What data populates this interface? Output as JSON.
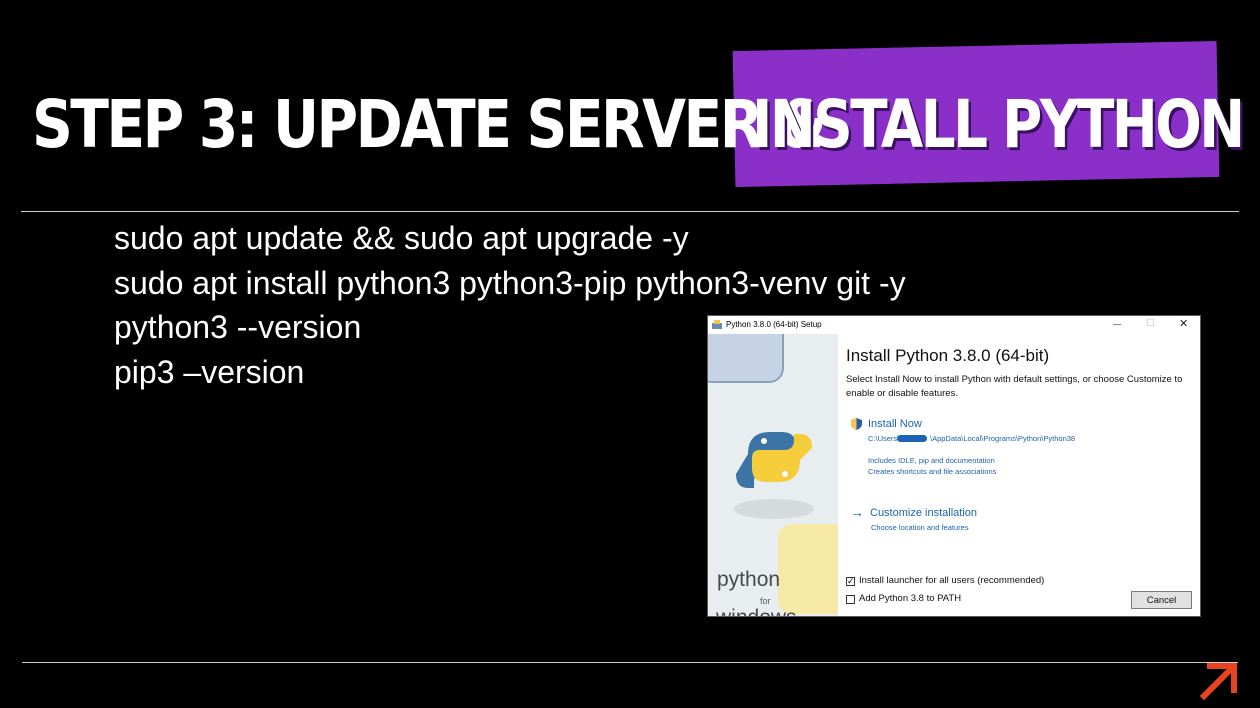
{
  "slide": {
    "title_left": "STEP 3: UPDATE SERVER &",
    "title_right": "INSTALL PYTHON",
    "accent_color": "#8b2fc9",
    "commands": [
      "sudo apt update && sudo apt upgrade -y",
      "sudo apt install python3 python3-pip python3-venv git -y",
      "python3 --version",
      "pip3 –version"
    ],
    "logo_icon": "arrow-up-right-icon",
    "logo_color": "#e8431f"
  },
  "dialog": {
    "window_title": "Python 3.8.0 (64-bit) Setup",
    "minimize": "—",
    "maximize": "☐",
    "close": "✕",
    "heading": "Install Python 3.8.0 (64-bit)",
    "description": "Select Install Now to install Python with default settings, or choose Customize to enable or disable features.",
    "install_now": {
      "label": "Install Now",
      "path_prefix": "C:\\Users\\",
      "path_suffix": "\\AppData\\Local\\Programs\\Python\\Python38",
      "line1": "Includes IDLE, pip and documentation",
      "line2": "Creates shortcuts and file associations"
    },
    "customize": {
      "label": "Customize installation",
      "sub": "Choose location and features"
    },
    "options": [
      {
        "label": "Install launcher for all users (recommended)",
        "checked": true
      },
      {
        "label": "Add Python 3.8 to PATH",
        "checked": false
      }
    ],
    "cancel_label": "Cancel",
    "side_text": {
      "python": "python",
      "for": "for",
      "windows": "windows"
    }
  }
}
